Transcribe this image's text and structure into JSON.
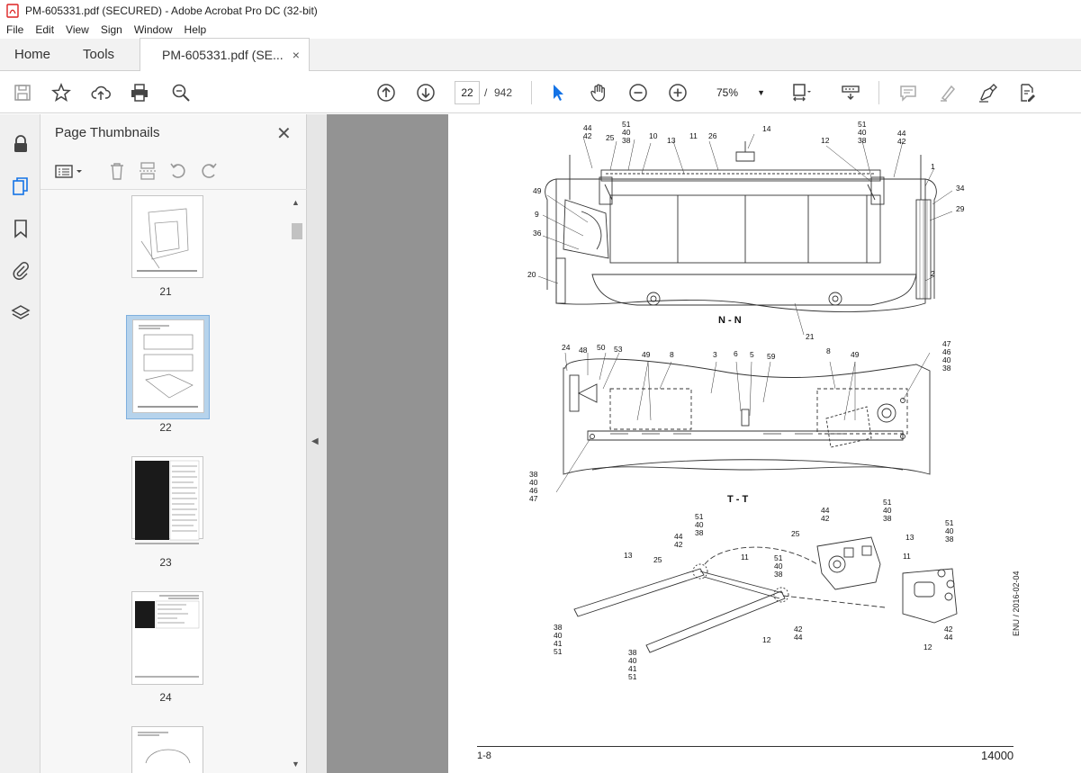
{
  "window": {
    "title": "PM-605331.pdf (SECURED) - Adobe Acrobat Pro DC (32-bit)"
  },
  "menu": [
    "File",
    "Edit",
    "View",
    "Sign",
    "Window",
    "Help"
  ],
  "tabs": {
    "home": "Home",
    "tools": "Tools",
    "doc": "PM-605331.pdf (SE...",
    "doc_close": "×"
  },
  "toolbar": {
    "current_page": "22",
    "page_sep": "/",
    "page_count": "942",
    "zoom": "75%"
  },
  "panel": {
    "title": "Page Thumbnails",
    "close": "✕",
    "thumbnails": [
      {
        "label": "21"
      },
      {
        "label": "22"
      },
      {
        "label": "23"
      },
      {
        "label": "24"
      }
    ]
  },
  "drawing": {
    "section_nn": "N - N",
    "section_tt": "T - T",
    "footer_left": "1-8",
    "footer_right": "14000",
    "side_stamp": "ENU / 2016-02-04",
    "labels_top": [
      "44",
      "42",
      "51",
      "40",
      "38",
      "25",
      "10",
      "13",
      "11",
      "26",
      "14",
      "12",
      "51",
      "40",
      "38",
      "44",
      "42",
      "1",
      "34",
      "29",
      "49",
      "9",
      "36",
      "20",
      "2",
      "21"
    ],
    "labels_mid": [
      "24",
      "48",
      "50",
      "53",
      "49",
      "8",
      "3",
      "6",
      "5",
      "59",
      "8",
      "49",
      "47",
      "46",
      "40",
      "38",
      "38",
      "40",
      "46",
      "47"
    ],
    "labels_bottom": [
      "51",
      "40",
      "38",
      "44",
      "42",
      "13",
      "25",
      "11",
      "51",
      "40",
      "38",
      "38",
      "40",
      "41",
      "51",
      "42",
      "44",
      "12",
      "38",
      "40",
      "41",
      "51",
      "44",
      "42",
      "51",
      "40",
      "38",
      "13",
      "25",
      "11",
      "51",
      "40",
      "38",
      "42",
      "44",
      "12"
    ]
  }
}
